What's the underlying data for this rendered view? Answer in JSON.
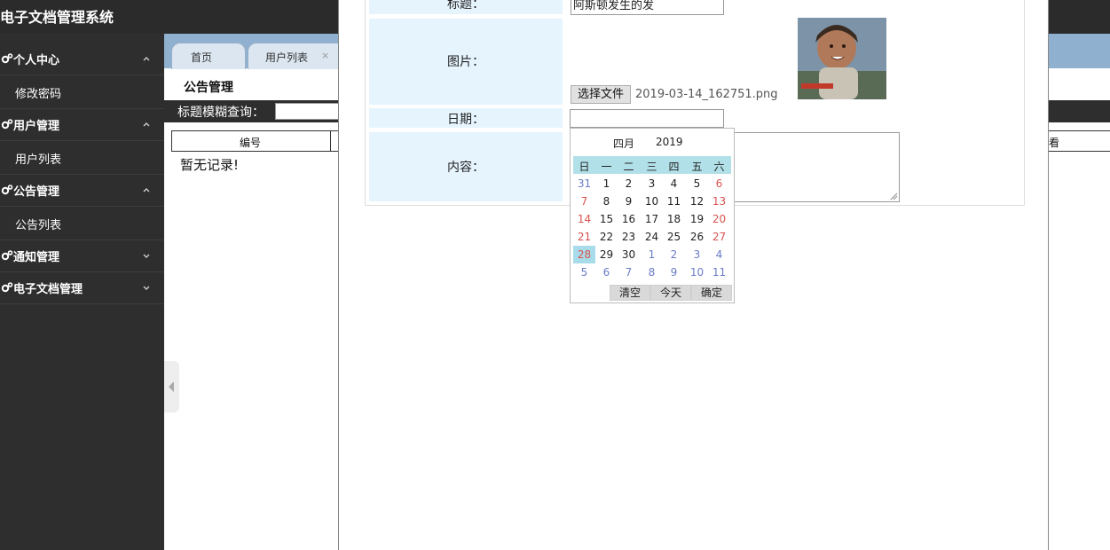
{
  "app": {
    "title": "电子文档管理系统"
  },
  "sidebar": {
    "groups": [
      {
        "label": "个人中心",
        "expanded": true,
        "items": [
          {
            "label": "修改密码"
          }
        ]
      },
      {
        "label": "用户管理",
        "expanded": true,
        "items": [
          {
            "label": "用户列表"
          }
        ]
      },
      {
        "label": "公告管理",
        "expanded": true,
        "items": [
          {
            "label": "公告列表"
          }
        ]
      },
      {
        "label": "通知管理",
        "expanded": false,
        "items": []
      },
      {
        "label": "电子文档管理",
        "expanded": false,
        "items": []
      }
    ]
  },
  "tabs": [
    {
      "label": "首页"
    },
    {
      "label": "用户列表",
      "close": "×"
    }
  ],
  "main": {
    "section_title": "公告管理",
    "search_label": "标题模糊查询：",
    "table_headers": [
      "编号",
      "看"
    ],
    "empty_text": "暂无记录!"
  },
  "form": {
    "title_label": "标题：",
    "title_value": "阿斯顿发生的发",
    "image_label": "图片：",
    "file_button": "选择文件",
    "file_name": "2019-03-14_162751.png",
    "date_label": "日期：",
    "date_value": "",
    "content_label": "内容："
  },
  "datepicker": {
    "month": "四月",
    "year": "2019",
    "weekdays": [
      "日",
      "一",
      "二",
      "三",
      "四",
      "五",
      "六"
    ],
    "weeks": [
      [
        "31",
        "1",
        "2",
        "3",
        "4",
        "5",
        "6"
      ],
      [
        "7",
        "8",
        "9",
        "10",
        "11",
        "12",
        "13"
      ],
      [
        "14",
        "15",
        "16",
        "17",
        "18",
        "19",
        "20"
      ],
      [
        "21",
        "22",
        "23",
        "24",
        "25",
        "26",
        "27"
      ],
      [
        "28",
        "29",
        "30",
        "1",
        "2",
        "3",
        "4"
      ],
      [
        "5",
        "6",
        "7",
        "8",
        "9",
        "10",
        "11"
      ]
    ],
    "selected_day": "28",
    "buttons": {
      "clear": "清空",
      "today": "今天",
      "ok": "确定"
    }
  },
  "colors": {
    "sidebar_bg": "#2e2e2e",
    "tabs_bg": "#8fb1cf",
    "form_label_bg": "#e6f4fe",
    "picker_header_bg": "#b2e0e8",
    "weekend": "#d9534f",
    "other_month": "#6a7cc8"
  }
}
